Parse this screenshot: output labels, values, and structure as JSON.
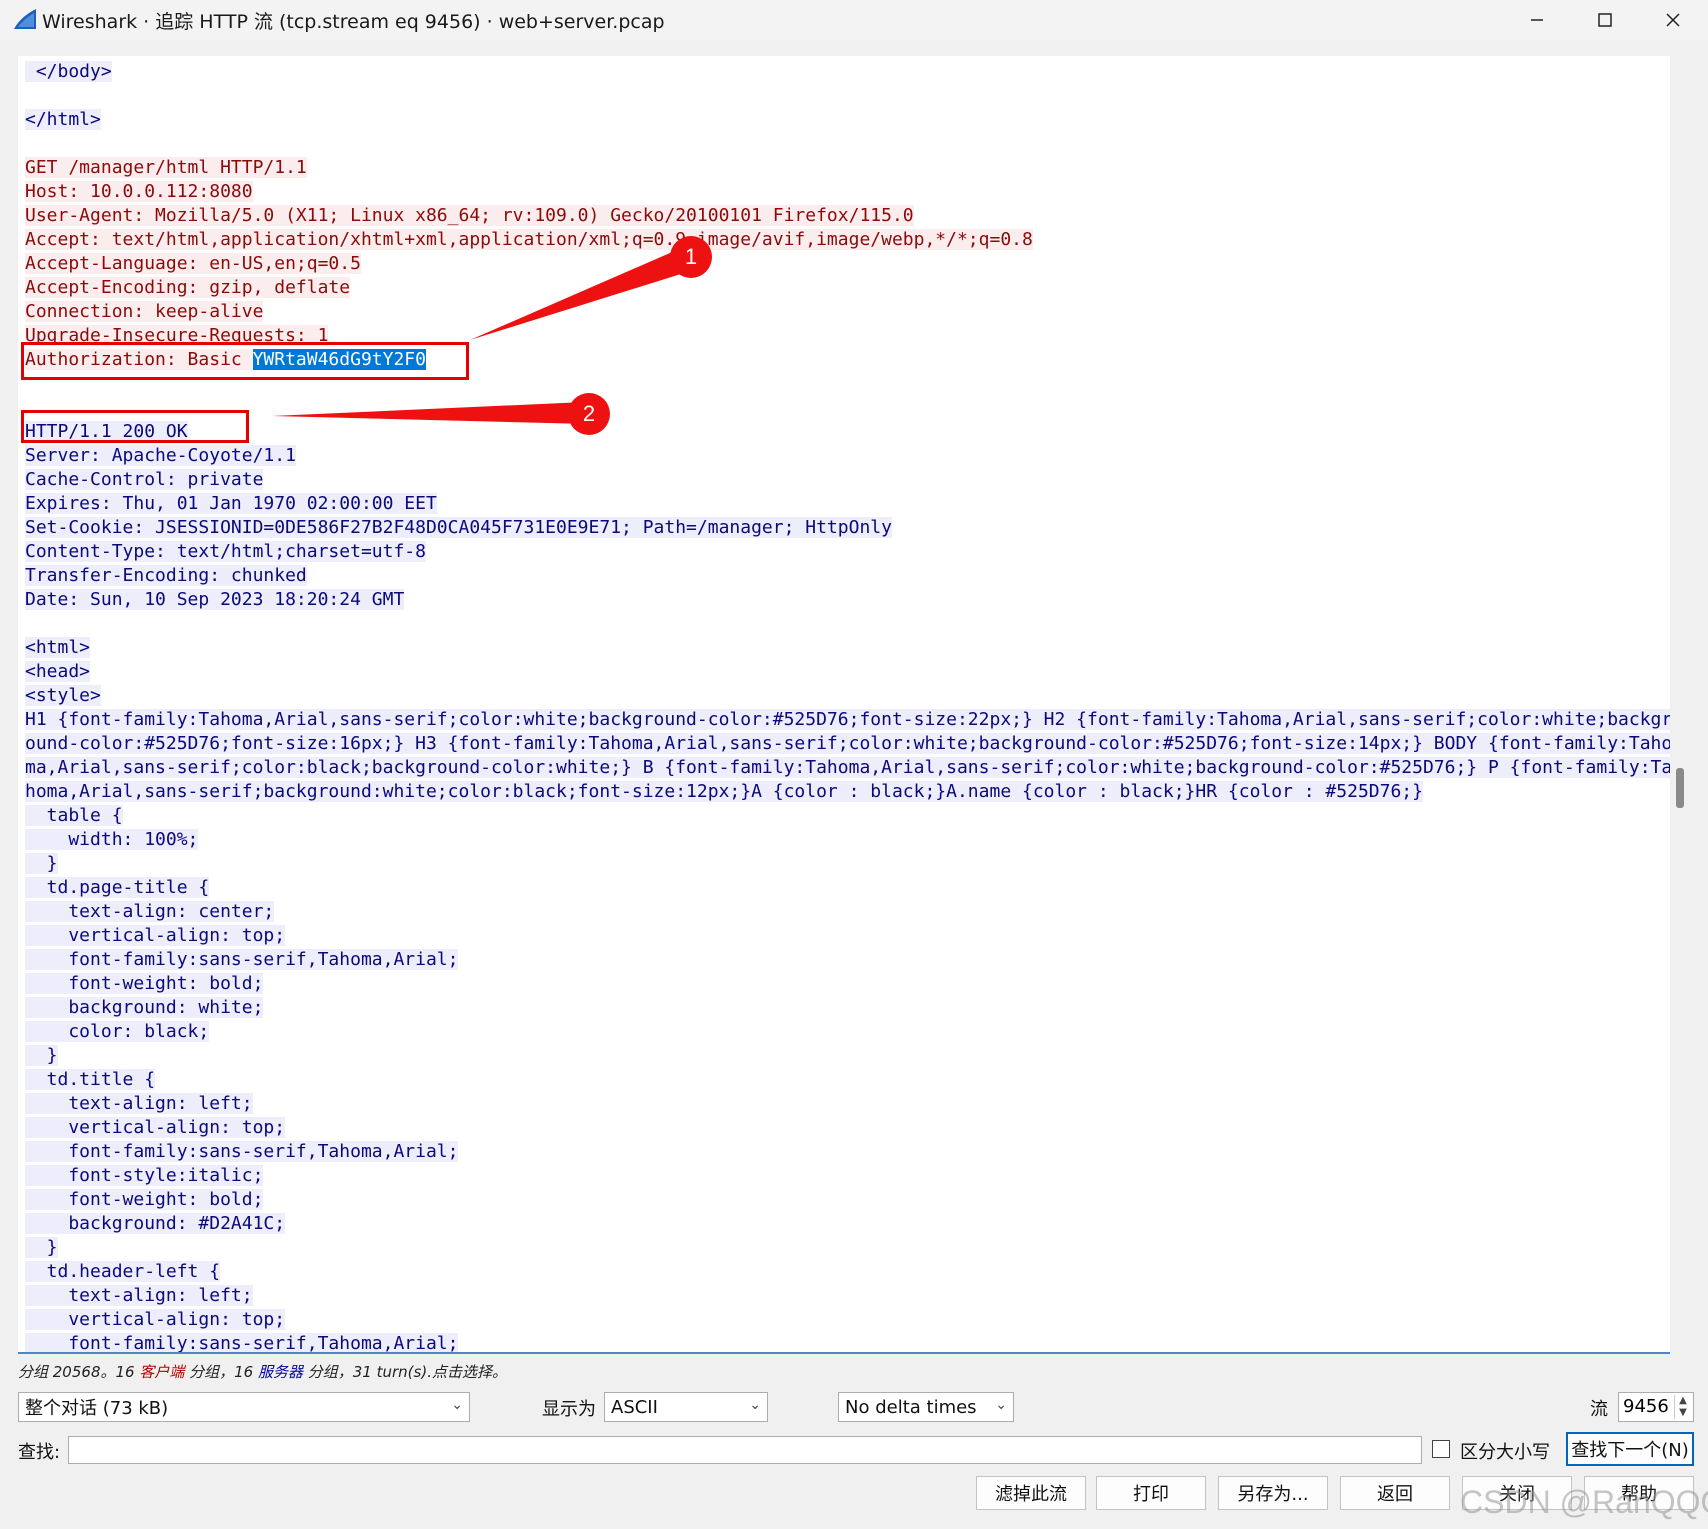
{
  "window": {
    "title": "Wireshark · 追踪 HTTP 流 (tcp.stream eq 9456) · web+server.pcap",
    "icon": "wireshark-fin-icon",
    "controls": {
      "minimize": "minimize-icon",
      "maximize": "maximize-icon",
      "close": "close-icon"
    }
  },
  "colors": {
    "client_bg": "#fbeded",
    "client_fg": "#8b0a0a",
    "server_bg": "#ededfb",
    "server_fg": "#0a0a7a",
    "selection": "#0078d7",
    "annotation": "#e60000"
  },
  "stream": {
    "lines": [
      {
        "t": " </body>",
        "k": "s"
      },
      {
        "t": "",
        "k": ""
      },
      {
        "t": "</html>",
        "k": "s"
      },
      {
        "t": "",
        "k": ""
      },
      {
        "t": "GET /manager/html HTTP/1.1",
        "k": "c"
      },
      {
        "t": "Host: 10.0.0.112:8080",
        "k": "c"
      },
      {
        "t": "User-Agent: Mozilla/5.0 (X11; Linux x86_64; rv:109.0) Gecko/20100101 Firefox/115.0",
        "k": "c"
      },
      {
        "t": "Accept: text/html,application/xhtml+xml,application/xml;q=0.9,image/avif,image/webp,*/*;q=0.8",
        "k": "c"
      },
      {
        "t": "Accept-Language: en-US,en;q=0.5",
        "k": "c"
      },
      {
        "t": "Accept-Encoding: gzip, deflate",
        "k": "c"
      },
      {
        "t": "Connection: keep-alive",
        "k": "c"
      },
      {
        "t": "Upgrade-Insecure-Requests: 1",
        "k": "c"
      },
      {
        "t": "Authorization: Basic ",
        "k": "c",
        "sel": "YWRtaW46dG9tY2F0"
      },
      {
        "t": "",
        "k": ""
      },
      {
        "t": "",
        "k": ""
      },
      {
        "t": "HTTP/1.1 200 OK",
        "k": "s"
      },
      {
        "t": "Server: Apache-Coyote/1.1",
        "k": "s"
      },
      {
        "t": "Cache-Control: private",
        "k": "s"
      },
      {
        "t": "Expires: Thu, 01 Jan 1970 02:00:00 EET",
        "k": "s"
      },
      {
        "t": "Set-Cookie: JSESSIONID=0DE586F27B2F48D0CA045F731E0E9E71; Path=/manager; HttpOnly",
        "k": "s"
      },
      {
        "t": "Content-Type: text/html;charset=utf-8",
        "k": "s"
      },
      {
        "t": "Transfer-Encoding: chunked",
        "k": "s"
      },
      {
        "t": "Date: Sun, 10 Sep 2023 18:20:24 GMT",
        "k": "s"
      },
      {
        "t": "",
        "k": ""
      },
      {
        "t": "<html>",
        "k": "s"
      },
      {
        "t": "<head>",
        "k": "s"
      },
      {
        "t": "<style>",
        "k": "s"
      },
      {
        "t": "H1 {font-family:Tahoma,Arial,sans-serif;color:white;background-color:#525D76;font-size:22px;} H2 {font-family:Tahoma,Arial,sans-serif;color:white;backgr",
        "k": "s"
      },
      {
        "t": "ound-color:#525D76;font-size:16px;} H3 {font-family:Tahoma,Arial,sans-serif;color:white;background-color:#525D76;font-size:14px;} BODY {font-family:Taho",
        "k": "s"
      },
      {
        "t": "ma,Arial,sans-serif;color:black;background-color:white;} B {font-family:Tahoma,Arial,sans-serif;color:white;background-color:#525D76;} P {font-family:Ta",
        "k": "s"
      },
      {
        "t": "homa,Arial,sans-serif;background:white;color:black;font-size:12px;}A {color : black;}A.name {color : black;}HR {color : #525D76;}",
        "k": "s"
      },
      {
        "t": "  table {",
        "k": "s"
      },
      {
        "t": "    width: 100%;",
        "k": "s"
      },
      {
        "t": "  }",
        "k": "s"
      },
      {
        "t": "  td.page-title {",
        "k": "s"
      },
      {
        "t": "    text-align: center;",
        "k": "s"
      },
      {
        "t": "    vertical-align: top;",
        "k": "s"
      },
      {
        "t": "    font-family:sans-serif,Tahoma,Arial;",
        "k": "s"
      },
      {
        "t": "    font-weight: bold;",
        "k": "s"
      },
      {
        "t": "    background: white;",
        "k": "s"
      },
      {
        "t": "    color: black;",
        "k": "s"
      },
      {
        "t": "  }",
        "k": "s"
      },
      {
        "t": "  td.title {",
        "k": "s"
      },
      {
        "t": "    text-align: left;",
        "k": "s"
      },
      {
        "t": "    vertical-align: top;",
        "k": "s"
      },
      {
        "t": "    font-family:sans-serif,Tahoma,Arial;",
        "k": "s"
      },
      {
        "t": "    font-style:italic;",
        "k": "s"
      },
      {
        "t": "    font-weight: bold;",
        "k": "s"
      },
      {
        "t": "    background: #D2A41C;",
        "k": "s"
      },
      {
        "t": "  }",
        "k": "s"
      },
      {
        "t": "  td.header-left {",
        "k": "s"
      },
      {
        "t": "    text-align: left;",
        "k": "s"
      },
      {
        "t": "    vertical-align: top;",
        "k": "s"
      },
      {
        "t": "    font-family:sans-serif,Tahoma,Arial;",
        "k": "s"
      }
    ]
  },
  "annotations": {
    "badge1": "1",
    "badge2": "2"
  },
  "summary": {
    "prefix": "分组 20568。16 ",
    "client": "客户端",
    "mid": " 分组，16 ",
    "server": "服务器",
    "suffix": " 分组，31 turn(s).点击选择。"
  },
  "controls": {
    "conversation": "整个对话 (73 kB)",
    "show_as_label": "显示为",
    "show_as": "ASCII",
    "delta": "No delta times",
    "stream_label": "流",
    "stream_value": "9456",
    "find_label": "查找:",
    "find_value": "",
    "case_label": "区分大小写",
    "find_next": "查找下一个(N)"
  },
  "buttons": {
    "filter_out": "滤掉此流",
    "print": "打印",
    "save_as": "另存为...",
    "back": "返回",
    "close": "关闭",
    "help": "帮助"
  },
  "watermark": "CSDN @RanQQQ"
}
